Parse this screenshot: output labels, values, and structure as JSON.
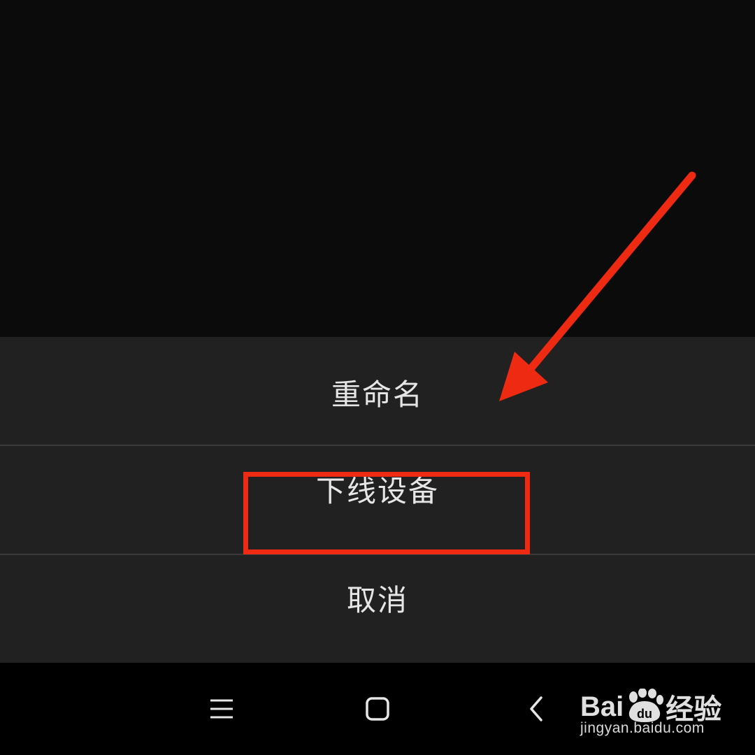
{
  "action_sheet": {
    "items": [
      {
        "label": "重命名"
      },
      {
        "label": "下线设备"
      },
      {
        "label": "取消"
      }
    ]
  },
  "annotation": {
    "color": "#ee2b12",
    "highlighted_item": "下线设备"
  },
  "nav_bar": {
    "menu_icon": "menu-icon",
    "home_icon": "home-icon",
    "back_icon": "back-icon"
  },
  "watermark": {
    "brand_prefix": "Bai",
    "brand_suffix": "经验",
    "logo_icon": "paw-du-icon",
    "url": "jingyan.baidu.com"
  }
}
